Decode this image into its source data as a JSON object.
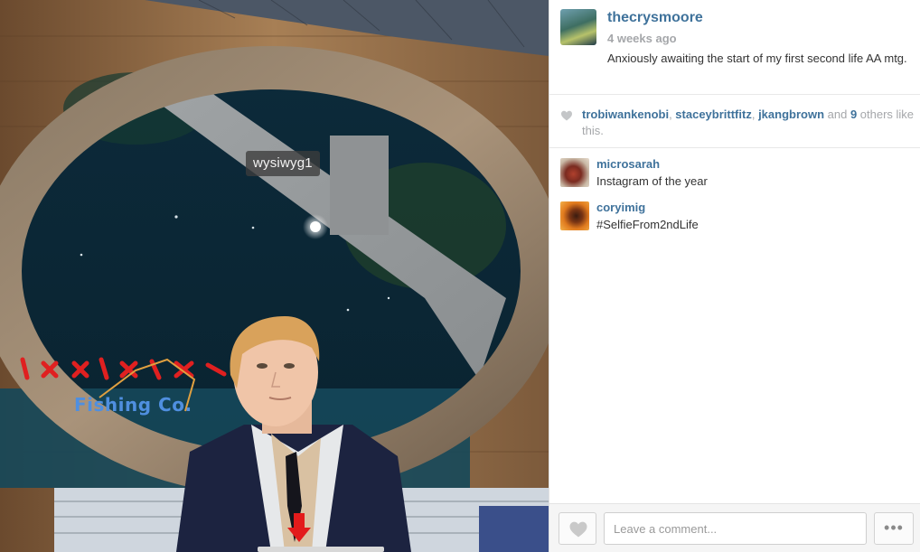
{
  "photo": {
    "avatar_nametag": "wysiwyg1",
    "sign_line_1": "I X X I X",
    "sign_line_2": "Fishing Co."
  },
  "post": {
    "owner": "thecrysmoore",
    "time": "4 weeks ago",
    "caption": "Anxiously awaiting the start of my first second life AA mtg."
  },
  "likes": {
    "users": [
      "trobiwankenobi",
      "staceybrittfitz",
      "jkangbrown"
    ],
    "sep1": ", ",
    "sep2": ", ",
    "and_text": " and ",
    "others_count": "9",
    "others_suffix": " others like this."
  },
  "comments": [
    {
      "user": "microsarah",
      "text": "Instagram of the year"
    },
    {
      "user": "coryimig",
      "text": "#SelfieFrom2ndLife"
    }
  ],
  "footer": {
    "comment_placeholder": "Leave a comment...",
    "more_label": "•••"
  },
  "colors": {
    "link_blue": "#3f729b",
    "meta_gray": "#a5a7aa"
  },
  "icons": {
    "like": "heart-icon",
    "more": "ellipsis-icon",
    "down": "red-down-arrow-icon"
  }
}
